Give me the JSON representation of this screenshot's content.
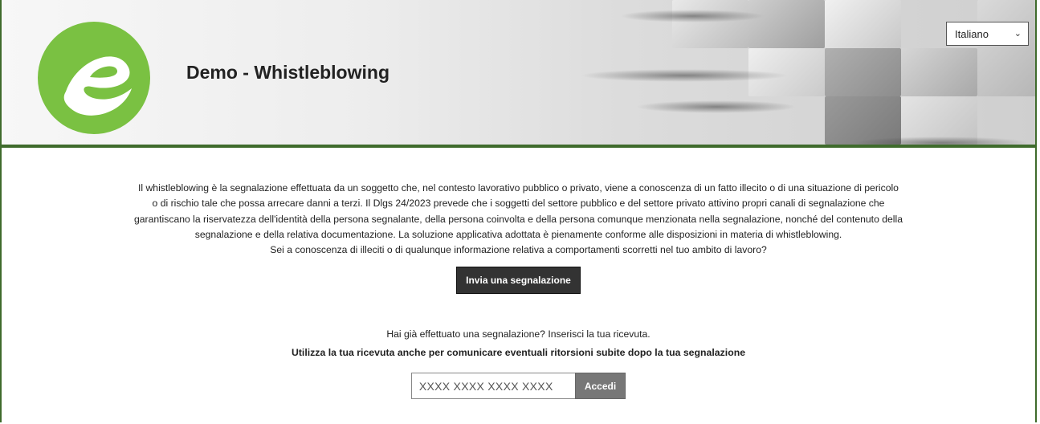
{
  "header": {
    "title": "Demo - Whistleblowing",
    "language": {
      "selected": "Italiano"
    },
    "colors": {
      "brand_green": "#7ac142",
      "border_green": "#3f6b2c"
    },
    "logo_icon": "e-logo-icon"
  },
  "main": {
    "intro_lines": [
      "Il whistleblowing è la segnalazione effettuata da un soggetto che, nel contesto lavorativo pubblico o privato, viene a conoscenza di un fatto illecito o di una situazione di pericolo",
      "o di rischio tale che possa arrecare danni a terzi. Il Dlgs 24/2023 prevede che i soggetti del settore pubblico e del settore privato attivino propri canali di segnalazione che",
      "garantiscano la riservatezza dell'identità della persona segnalante, della persona coinvolta e della persona comunque menzionata nella segnalazione, nonché del contenuto della",
      "segnalazione e della relativa documentazione. La soluzione applicativa adottata è pienamente conforme alle disposizioni in materia di whistleblowing.",
      "Sei a conoscenza di illeciti o di qualunque informazione relativa a comportamenti scorretti nel tuo ambito di lavoro?"
    ],
    "report_button": "Invia una segnalazione",
    "receipt_question": "Hai già effettuato una segnalazione? Inserisci la tua ricevuta.",
    "receipt_note": "Utilizza la tua ricevuta anche per comunicare eventuali ritorsioni subite dopo la tua segnalazione",
    "receipt_input": {
      "placeholder": "XXXX XXXX XXXX XXXX",
      "value": ""
    },
    "login_button": "Accedi"
  }
}
